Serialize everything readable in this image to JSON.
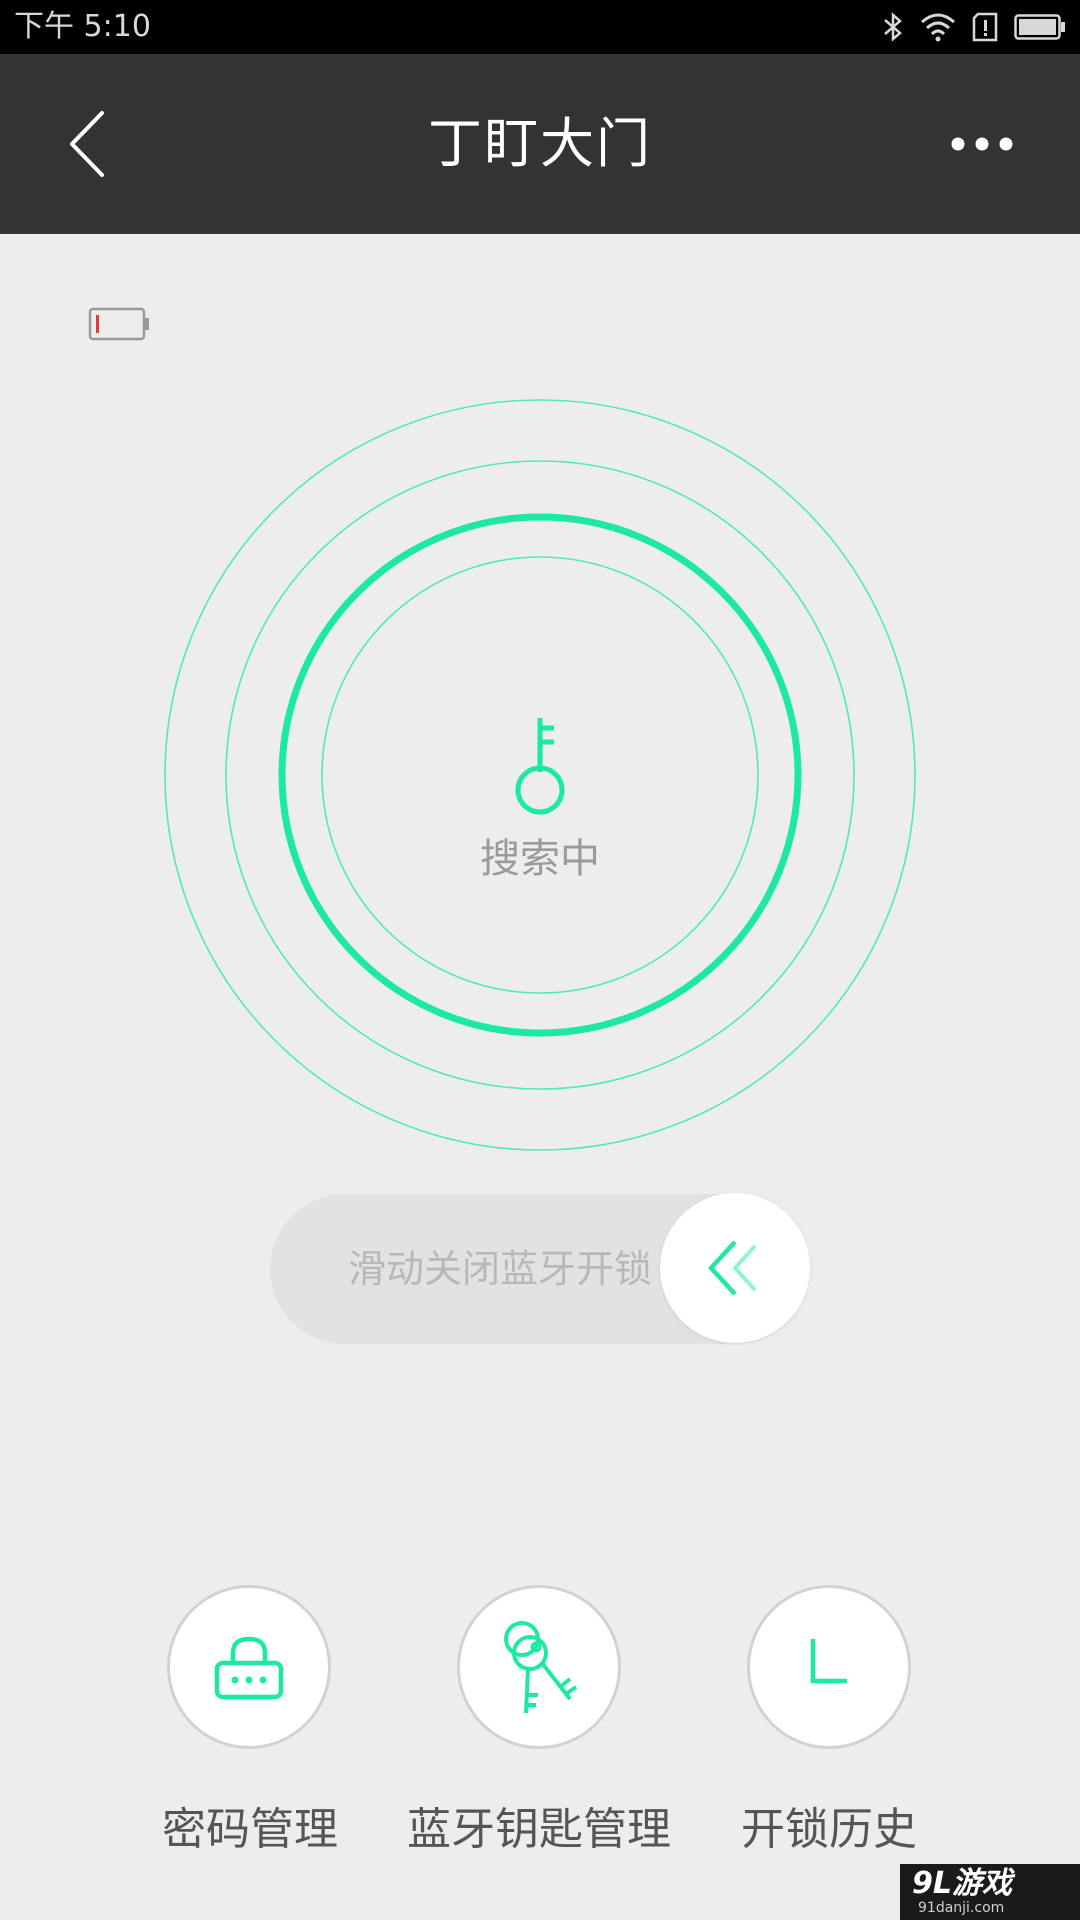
{
  "status_bar": {
    "time": "下午 5:10",
    "icons": [
      "bluetooth-icon",
      "wifi-icon",
      "alert-icon",
      "battery-icon"
    ]
  },
  "nav": {
    "title": "丁盯大门",
    "back_icon": "chevron-left-icon",
    "more_icon": "more-dots-icon"
  },
  "lock": {
    "battery_icon": "low-battery-icon",
    "battery_level": 0.1,
    "status_text": "搜索中",
    "status_icon": "key-icon"
  },
  "slider": {
    "label": "滑动关闭蓝牙开锁",
    "knob_icon": "double-chevron-left-icon"
  },
  "actions": [
    {
      "label": "密码管理",
      "icon": "keypad-lock-icon"
    },
    {
      "label": "蓝牙钥匙管理",
      "icon": "keys-icon"
    },
    {
      "label": "开锁历史",
      "icon": "clock-icon"
    }
  ],
  "watermark": {
    "logo": "9L游戏",
    "url": "91danji.com"
  },
  "colors": {
    "accent": "#1de9a0",
    "nav_bg": "#333333",
    "page_bg": "#ededed",
    "low_battery": "#e53935"
  }
}
